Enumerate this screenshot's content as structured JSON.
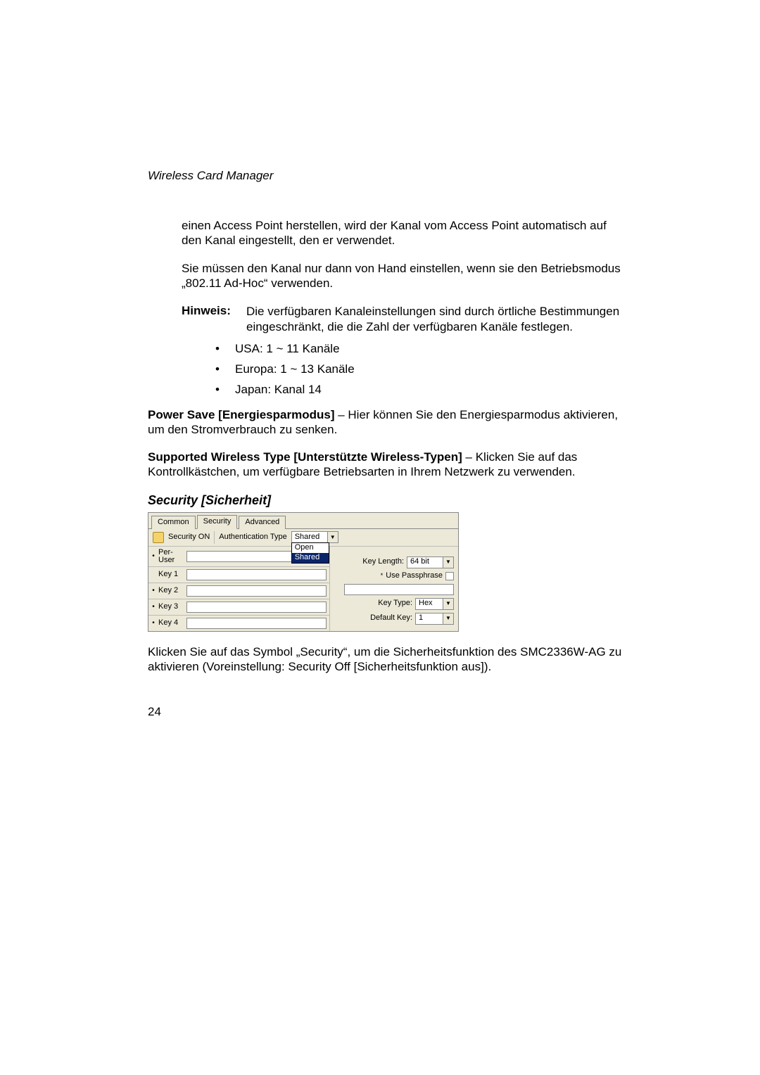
{
  "header": "Wireless Card Manager",
  "p1": "einen Access Point herstellen, wird der Kanal vom Access Point automatisch auf den Kanal eingestellt, den er verwendet.",
  "p2": "Sie müssen den Kanal nur dann von Hand einstellen, wenn sie den Betriebsmodus „802.11 Ad-Hoc“ verwenden.",
  "hinweis_label": "Hinweis:",
  "hinweis_text": "Die verfügbaren Kanaleinstellungen sind durch örtliche Bestimmungen eingeschränkt, die die Zahl der verfügbaren Kanäle festlegen.",
  "bullets": [
    "USA: 1 ~ 11 Kanäle",
    "Europa: 1 ~ 13 Kanäle",
    "Japan: Kanal 14"
  ],
  "p3_bold": "Power Save [Energiesparmodus]",
  "p3_rest": " – Hier können Sie den Energiesparmodus aktivieren, um den Stromverbrauch zu senken.",
  "p4_bold": "Supported Wireless Type [Unterstützte Wireless-Typen]",
  "p4_rest": " – Klicken Sie auf das Kontrollkästchen, um verfügbare Betriebsarten in Ihrem Netzwerk zu verwenden.",
  "section": "Security [Sicherheit]",
  "shot": {
    "tabs": [
      "Common",
      "Security",
      "Advanced"
    ],
    "active_tab": 1,
    "security_on": "Security ON",
    "auth_label": "Authentication Type",
    "auth_value": "Shared",
    "auth_opts": [
      "Open",
      "Shared"
    ],
    "per_user": "Per-\nUser",
    "keys": [
      "Key 1",
      "Key 2",
      "Key 3",
      "Key 4"
    ],
    "key_length_label": "Key Length:",
    "key_length_value": "64 bit",
    "use_pass": "Use Passphrase",
    "key_type_label": "Key Type:",
    "key_type_value": "Hex",
    "default_key_label": "Default Key:",
    "default_key_value": "1"
  },
  "p5": "Klicken Sie auf das Symbol „Security“, um die Sicherheitsfunktion des SMC2336W-AG zu aktivieren  (Voreinstellung: Security Off [Sicherheitsfunktion aus]).",
  "page_num": "24"
}
